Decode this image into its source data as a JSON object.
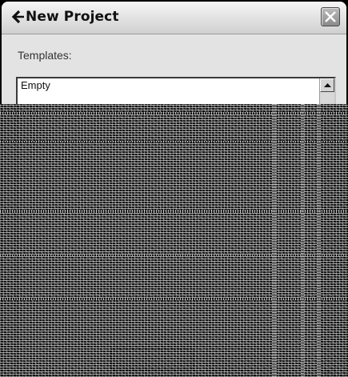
{
  "dialog": {
    "title": "New Project",
    "back_icon": "back-arrow-icon",
    "close_icon": "close-x-icon"
  },
  "templates": {
    "label": "Templates:",
    "items": [
      "Empty"
    ],
    "scroll_up_icon": "arrow-up-icon",
    "scroll_down_icon": "arrow-down-icon"
  },
  "colors": {
    "window_bg": "#e3e3e3",
    "list_bg": "#ffffff",
    "text": "#111111"
  }
}
